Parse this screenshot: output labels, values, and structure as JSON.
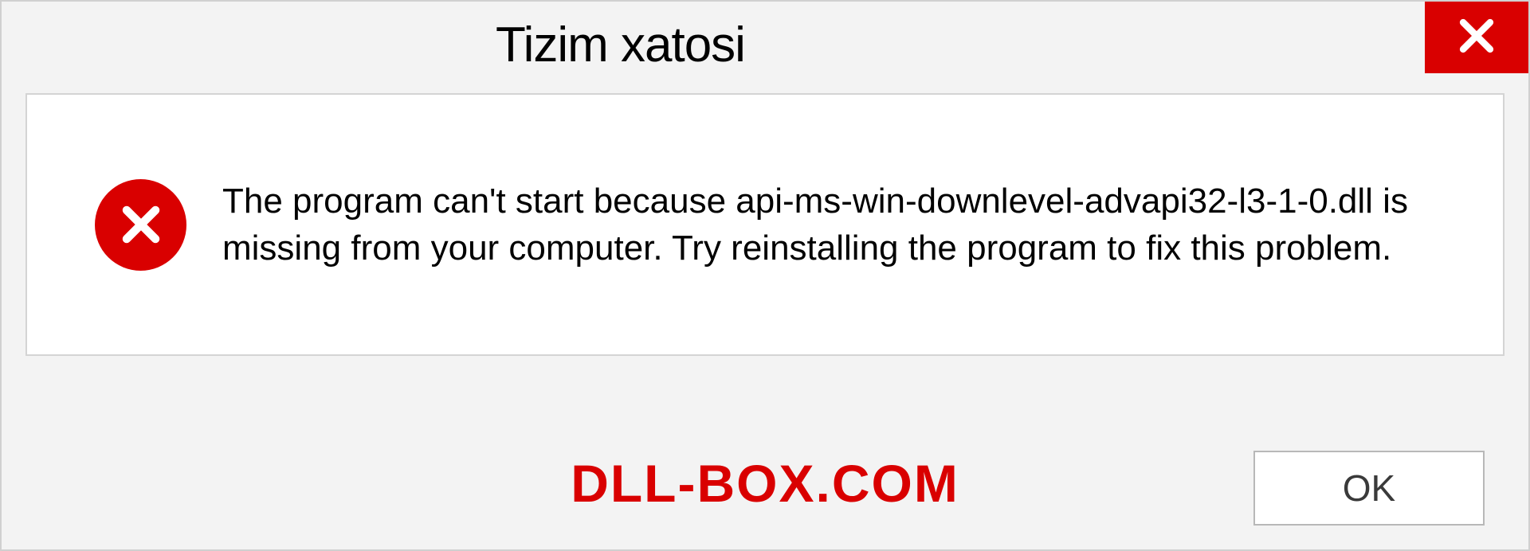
{
  "dialog": {
    "title": "Tizim xatosi",
    "message": "The program can't start because api-ms-win-downlevel-advapi32-l3-1-0.dll is missing from your computer. Try reinstalling the program to fix this problem.",
    "ok_label": "OK",
    "watermark": "DLL-BOX.COM"
  },
  "colors": {
    "error_red": "#d90000",
    "panel_bg": "#f3f3f3",
    "content_bg": "#ffffff"
  }
}
